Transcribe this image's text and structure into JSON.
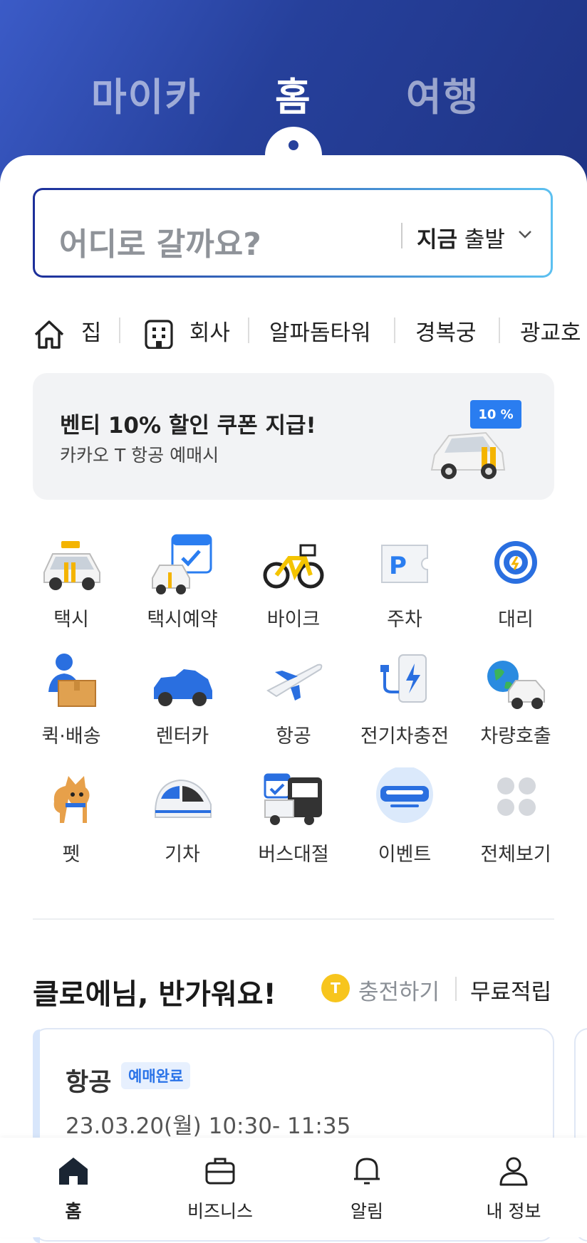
{
  "top_tabs": {
    "mycar": "마이카",
    "home": "홈",
    "travel": "여행"
  },
  "search": {
    "placeholder": "어디로 갈까요?",
    "time_bold": "지금",
    "time_text": " 출발"
  },
  "places": {
    "home": "집",
    "work": "회사",
    "p1": "알파돔타워",
    "p2": "경복궁",
    "p3": "광교호"
  },
  "banner": {
    "title": "벤티 10% 할인 쿠폰 지급!",
    "subtitle": "카카오 T 항공 예매시",
    "badge": "10 %"
  },
  "services": {
    "taxi": "택시",
    "taxi_reserve": "택시예약",
    "bike": "바이크",
    "parking": "주차",
    "driver": "대리",
    "quick": "퀵·배송",
    "rentcar": "렌터카",
    "flight": "항공",
    "ev": "전기차충전",
    "car_call": "차량호출",
    "pet": "펫",
    "train": "기차",
    "bus": "버스대절",
    "event": "이벤트",
    "all": "전체보기"
  },
  "greeting": {
    "text": "클로에님, 반가워요!",
    "coin": "T",
    "charge": "충전하기",
    "free": "무료적립"
  },
  "card": {
    "title": "항공",
    "badge": "예매완료",
    "date": "23.03.20(월) 10:30- 11:35"
  },
  "bottom_nav": {
    "home": "홈",
    "business": "비즈니스",
    "alerts": "알림",
    "profile": "내 정보"
  },
  "colors": {
    "header": "#26409b",
    "accent": "#2a7df0",
    "coin": "#f7c51d"
  }
}
